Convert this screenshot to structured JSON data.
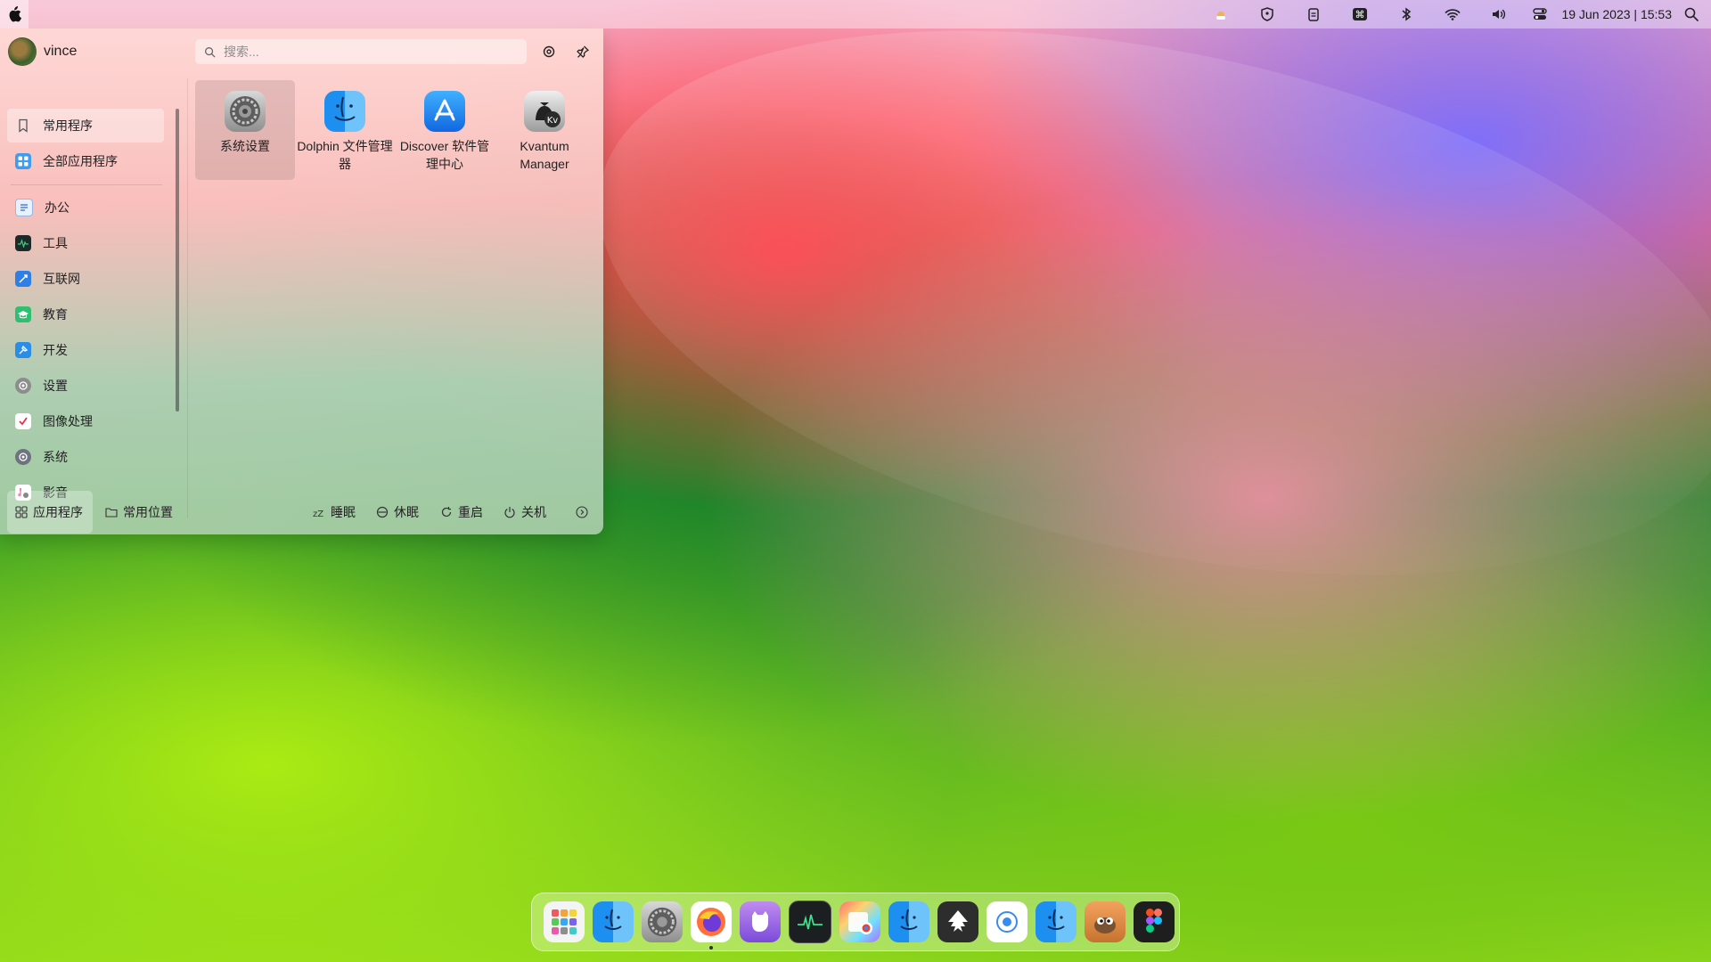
{
  "menubar": {
    "clock": "19 Jun 2023 | 15:53",
    "tray_icons": [
      "weather-icon",
      "shield-icon",
      "clipboard-icon",
      "command-icon",
      "bluetooth-icon",
      "wifi-icon",
      "volume-icon",
      "control-center-icon",
      "search-icon"
    ]
  },
  "launcher": {
    "username": "vince",
    "search_placeholder": "搜索...",
    "sidebar": [
      {
        "label": "常用程序",
        "icon": "bookmark-icon",
        "active": true
      },
      {
        "label": "全部应用程序",
        "icon": "grid-icon",
        "active": false
      },
      {
        "label": "办公",
        "icon": "office-icon",
        "active": false
      },
      {
        "label": "工具",
        "icon": "tools-icon",
        "active": false
      },
      {
        "label": "互联网",
        "icon": "internet-icon",
        "active": false
      },
      {
        "label": "教育",
        "icon": "education-icon",
        "active": false
      },
      {
        "label": "开发",
        "icon": "development-icon",
        "active": false
      },
      {
        "label": "设置",
        "icon": "settings-icon",
        "active": false
      },
      {
        "label": "图像处理",
        "icon": "graphics-icon",
        "active": false
      },
      {
        "label": "系统",
        "icon": "system-icon",
        "active": false
      },
      {
        "label": "影音",
        "icon": "multimedia-icon",
        "active": false
      }
    ],
    "apps": [
      {
        "label": "系统设置",
        "icon": "system-settings-icon"
      },
      {
        "label": "Dolphin 文件管理器",
        "icon": "dolphin-icon"
      },
      {
        "label": "Discover 软件管理中心",
        "icon": "discover-icon"
      },
      {
        "label": "Kvantum Manager",
        "icon": "kvantum-icon"
      }
    ],
    "footer": {
      "applications": "应用程序",
      "places": "常用位置",
      "sleep": "睡眠",
      "hibernate": "休眠",
      "restart": "重启",
      "shutdown": "关机"
    }
  },
  "dock": {
    "apps": [
      "app-launcher-icon",
      "finder-icon",
      "system-settings-icon",
      "firefox-icon",
      "github-icon",
      "system-monitor-icon",
      "image-viewer-icon",
      "finder-icon",
      "inkscape-icon",
      "browser-icon",
      "finder-icon",
      "gimp-icon",
      "figma-icon"
    ]
  }
}
